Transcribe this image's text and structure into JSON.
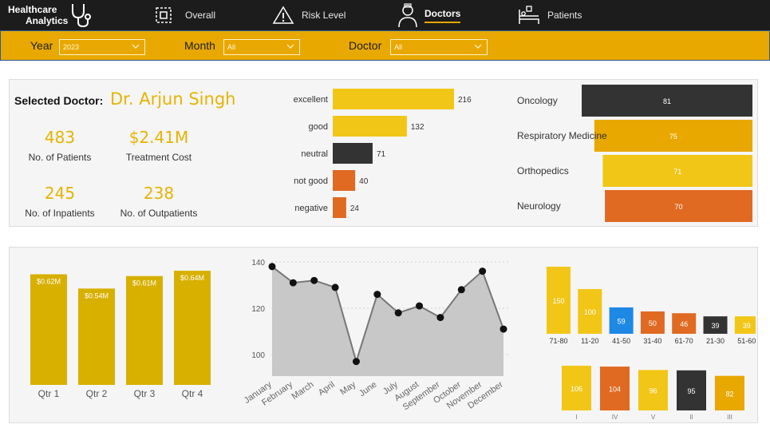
{
  "header": {
    "brand_line1": "Healthcare",
    "brand_line2": "Analytics",
    "nav": [
      {
        "label": "Overall",
        "icon": "grid-icon",
        "active": false
      },
      {
        "label": "Risk Level",
        "icon": "warning-icon",
        "active": false
      },
      {
        "label": "Doctors",
        "icon": "doctor-icon",
        "active": true
      },
      {
        "label": "Patients",
        "icon": "hospital-bed-icon",
        "active": false
      }
    ]
  },
  "filters": {
    "year_label": "Year",
    "year_value": "2023",
    "month_label": "Month",
    "month_value": "All",
    "doctor_label": "Doctor",
    "doctor_value": "All"
  },
  "doctor": {
    "selected_label": "Selected Doctor:",
    "name": "Dr. Arjun Singh",
    "kpis": [
      {
        "value": "483",
        "caption": "No. of Patients"
      },
      {
        "value": "$2.41M",
        "caption": "Treatment Cost"
      },
      {
        "value": "245",
        "caption": "No. of Inpatients"
      },
      {
        "value": "238",
        "caption": "No. of Outpatients"
      }
    ]
  },
  "colors": {
    "yellow": "#f1c617",
    "gold": "#d8b000",
    "amber": "#e8a800",
    "dark": "#333333",
    "orange": "#e06a22",
    "blue": "#1e88e5",
    "brand": "#e6b400",
    "area": "#c8c8c8"
  },
  "chart_data": [
    {
      "type": "bar",
      "orientation": "horizontal",
      "categories": [
        "excellent",
        "good",
        "neutral",
        "not good",
        "negative"
      ],
      "values": [
        216,
        132,
        71,
        40,
        24
      ],
      "colors": [
        "#f1c617",
        "#f1c617",
        "#333333",
        "#e06a22",
        "#e06a22"
      ]
    },
    {
      "type": "bar",
      "orientation": "horizontal",
      "categories": [
        "Oncology",
        "Respiratory Medicine",
        "Orthopedics",
        "Neurology"
      ],
      "values": [
        81,
        75,
        71,
        70
      ],
      "colors": [
        "#333333",
        "#e8a800",
        "#f1c617",
        "#e06a22"
      ]
    },
    {
      "type": "bar",
      "categories": [
        "Qtr 1",
        "Qtr 2",
        "Qtr 3",
        "Qtr 4"
      ],
      "values": [
        0.62,
        0.54,
        0.61,
        0.64
      ],
      "labels": [
        "$0.62M",
        "$0.54M",
        "$0.61M",
        "$0.64M"
      ],
      "ylim": [
        0,
        0.64
      ]
    },
    {
      "type": "area",
      "categories": [
        "January",
        "February",
        "March",
        "April",
        "May",
        "June",
        "July",
        "August",
        "September",
        "October",
        "November",
        "December"
      ],
      "values": [
        138,
        131,
        132,
        129,
        97,
        126,
        118,
        121,
        116,
        128,
        136,
        111
      ],
      "ylim": [
        90,
        140
      ],
      "yticks": [
        100,
        120,
        140
      ],
      "grid": true
    },
    {
      "type": "bar",
      "categories": [
        "71-80",
        "11-20",
        "41-50",
        "31-40",
        "61-70",
        "21-30",
        "51-60"
      ],
      "values": [
        150,
        100,
        59,
        50,
        46,
        39,
        39
      ],
      "colors": [
        "#f1c617",
        "#f1c617",
        "#1e88e5",
        "#e06a22",
        "#e06a22",
        "#333333",
        "#f1c617"
      ]
    },
    {
      "type": "bar",
      "categories": [
        "I",
        "IV",
        "V",
        "II",
        "III"
      ],
      "values": [
        106,
        104,
        96,
        95,
        82
      ],
      "colors": [
        "#f1c617",
        "#e06a22",
        "#f1c617",
        "#333333",
        "#e8a800"
      ]
    }
  ]
}
